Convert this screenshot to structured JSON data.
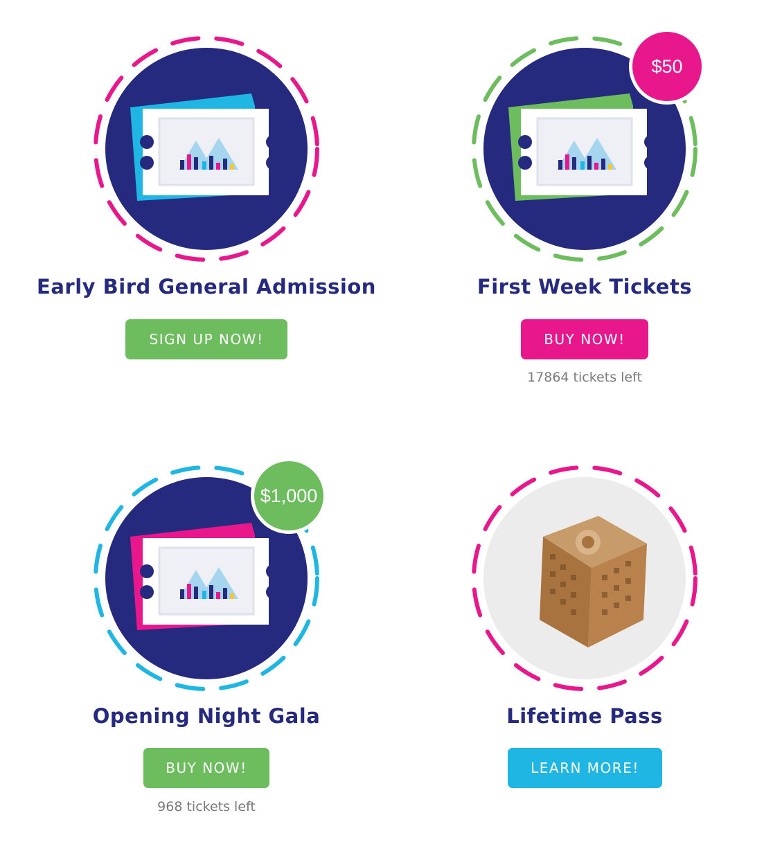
{
  "colors": {
    "navy": "#262a7f",
    "green": "#6dbd5f",
    "pink": "#e8188c",
    "cyan": "#1fb6e3"
  },
  "cards": [
    {
      "title": "Early Bird General Admission",
      "button_label": "SIGN UP NOW!",
      "ring_color": "pink",
      "ticket_color": "cyan",
      "button_color": "green",
      "image": "ticket-illustration"
    },
    {
      "title": "First Week Tickets",
      "button_label": "BUY NOW!",
      "tickets_left": "17864 tickets left",
      "price": "$50",
      "ring_color": "green",
      "ticket_color": "green",
      "button_color": "pink",
      "image": "ticket-illustration"
    },
    {
      "title": "Opening Night Gala",
      "button_label": "BUY NOW!",
      "tickets_left": "968 tickets left",
      "price": "$1,000",
      "ring_color": "cyan",
      "ticket_color": "pink",
      "button_color": "green",
      "image": "ticket-illustration"
    },
    {
      "title": "Lifetime Pass",
      "button_label": "LEARN MORE!",
      "ring_color": "pink",
      "button_color": "cyan",
      "image": "wooden-laser-cut-box-photo"
    }
  ]
}
